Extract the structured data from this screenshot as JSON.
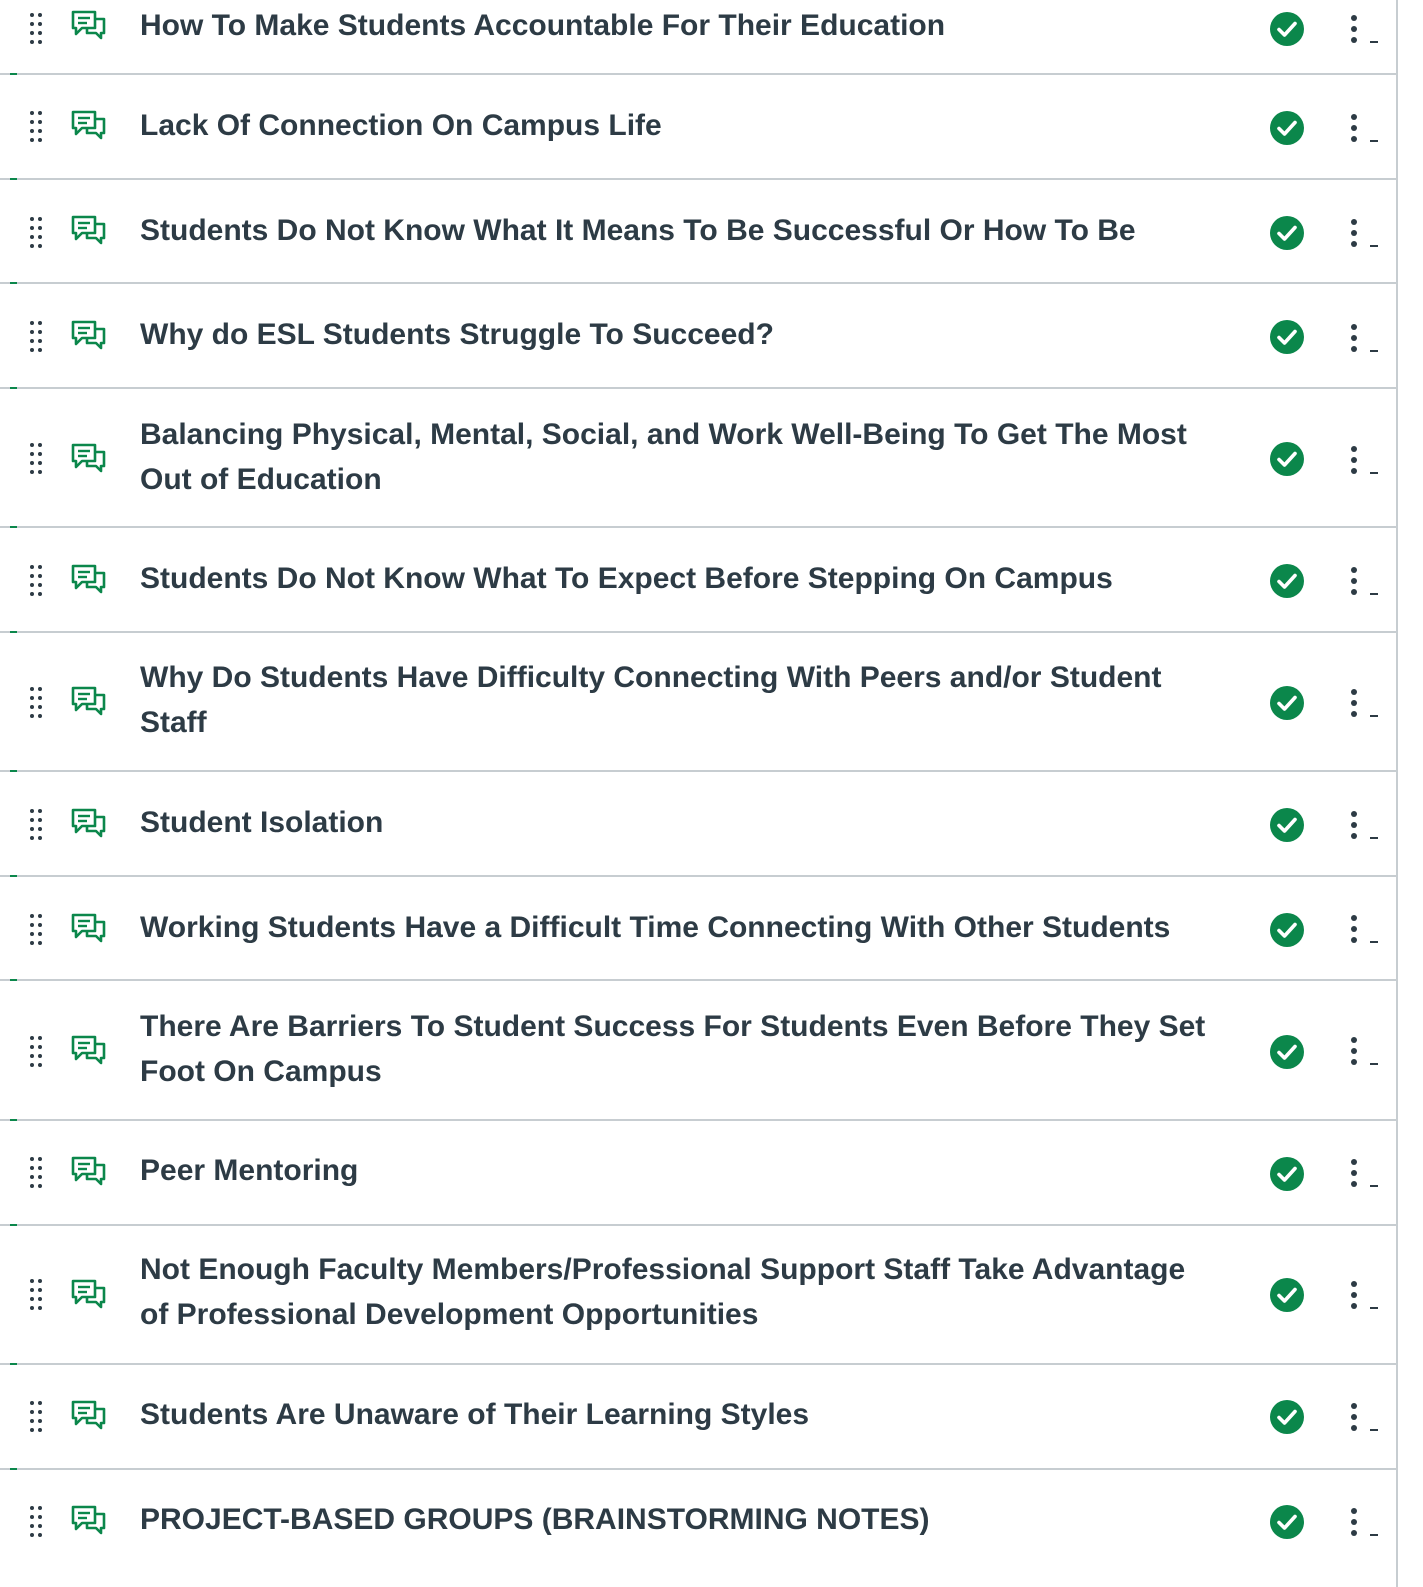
{
  "colors": {
    "accent": "#0b874b",
    "published": "#0b874b",
    "text": "#2d3b45",
    "divider": "#c7cdd1"
  },
  "icons": {
    "drag": "drag-handle-icon",
    "discussion": "discussion-icon",
    "published": "published-check-icon",
    "menu": "kebab-menu-icon"
  },
  "discussions": [
    {
      "title": "How To Make Students Accountable For Their Education",
      "published": true
    },
    {
      "title": "Lack Of Connection On Campus Life",
      "published": true
    },
    {
      "title": "Students Do Not Know What It Means To Be Successful Or How To Be",
      "published": true
    },
    {
      "title": "Why do ESL Students Struggle To Succeed?",
      "published": true
    },
    {
      "title": "Balancing Physical, Mental, Social, and Work Well-Being To Get The Most Out of Education",
      "published": true
    },
    {
      "title": "Students Do Not Know What To Expect Before Stepping On Campus",
      "published": true
    },
    {
      "title": "Why Do Students Have Difficulty Connecting With Peers and/or Student Staff",
      "published": true
    },
    {
      "title": "Student Isolation",
      "published": true
    },
    {
      "title": "Working Students Have a Difficult Time Connecting With Other Students",
      "published": true
    },
    {
      "title": "There Are Barriers To Student Success For Students Even Before They Set Foot On Campus",
      "published": true
    },
    {
      "title": "Peer Mentoring",
      "published": true
    },
    {
      "title": "Not Enough Faculty Members/Professional Support Staff Take Advantage of Professional Development Opportunities",
      "published": true
    },
    {
      "title": "Students Are Unaware of Their Learning Styles",
      "published": true
    },
    {
      "title": "PROJECT-BASED GROUPS (BRAINSTORMING NOTES)",
      "published": true
    }
  ]
}
